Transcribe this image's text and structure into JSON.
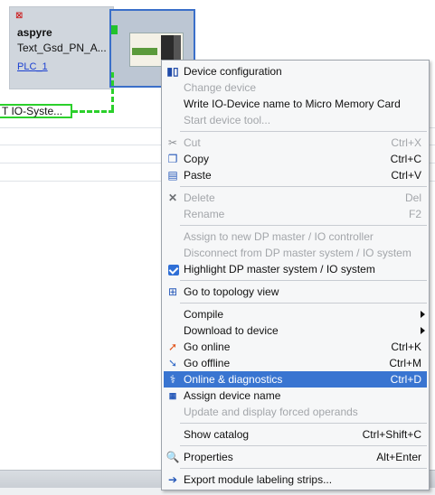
{
  "device": {
    "name": "aspyre",
    "type": "Text_Gsd_PN_A...",
    "controller_link": "PLC_1"
  },
  "io_system_label": "T IO-Syste...",
  "menu": {
    "items": [
      {
        "label": "Device configuration",
        "shortcut": "",
        "icon": "device-config-icon",
        "enabled": true
      },
      {
        "label": "Change device",
        "shortcut": "",
        "icon": "",
        "enabled": false
      },
      {
        "label": "Write IO-Device name to Micro Memory Card",
        "shortcut": "",
        "icon": "",
        "enabled": true
      },
      {
        "label": "Start device tool...",
        "shortcut": "",
        "icon": "",
        "enabled": false
      },
      {
        "label": "Cut",
        "shortcut": "Ctrl+X",
        "icon": "scissors-icon",
        "enabled": false
      },
      {
        "label": "Copy",
        "shortcut": "Ctrl+C",
        "icon": "copy-icon",
        "enabled": true
      },
      {
        "label": "Paste",
        "shortcut": "Ctrl+V",
        "icon": "paste-icon",
        "enabled": true
      },
      {
        "label": "Delete",
        "shortcut": "Del",
        "icon": "delete-icon",
        "enabled": false
      },
      {
        "label": "Rename",
        "shortcut": "F2",
        "icon": "",
        "enabled": false
      },
      {
        "label": "Assign to new DP master / IO controller",
        "shortcut": "",
        "icon": "",
        "enabled": false
      },
      {
        "label": "Disconnect from DP master system / IO system",
        "shortcut": "",
        "icon": "",
        "enabled": false
      },
      {
        "label": "Highlight DP master system / IO system",
        "shortcut": "",
        "icon": "checkbox-checked-icon",
        "enabled": true
      },
      {
        "label": "Go to topology view",
        "shortcut": "",
        "icon": "topology-icon",
        "enabled": true
      },
      {
        "label": "Compile",
        "shortcut": "",
        "icon": "",
        "enabled": true,
        "submenu": true
      },
      {
        "label": "Download to device",
        "shortcut": "",
        "icon": "",
        "enabled": true,
        "submenu": true
      },
      {
        "label": "Go online",
        "shortcut": "Ctrl+K",
        "icon": "go-online-icon",
        "enabled": true
      },
      {
        "label": "Go offline",
        "shortcut": "Ctrl+M",
        "icon": "go-offline-icon",
        "enabled": true
      },
      {
        "label": "Online & diagnostics",
        "shortcut": "Ctrl+D",
        "icon": "diagnostics-icon",
        "enabled": true,
        "highlighted": true
      },
      {
        "label": "Assign device name",
        "shortcut": "",
        "icon": "name-icon",
        "enabled": true
      },
      {
        "label": "Update and display forced operands",
        "shortcut": "",
        "icon": "",
        "enabled": false
      },
      {
        "label": "Show catalog",
        "shortcut": "Ctrl+Shift+C",
        "icon": "",
        "enabled": true
      },
      {
        "label": "Properties",
        "shortcut": "Alt+Enter",
        "icon": "properties-icon",
        "enabled": true
      },
      {
        "label": "Export module labeling strips...",
        "shortcut": "",
        "icon": "export-icon",
        "enabled": true
      }
    ]
  },
  "colors": {
    "highlight": "#3975d1",
    "link": "#2bd02b",
    "selection_border": "#3a6fc9"
  }
}
